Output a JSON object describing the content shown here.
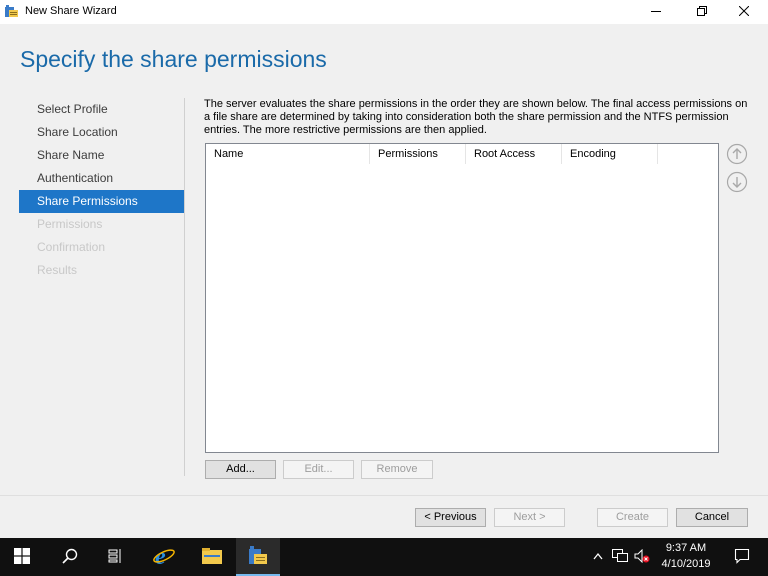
{
  "window": {
    "title": "New Share Wizard",
    "heading": "Specify the share permissions"
  },
  "nav": {
    "items": [
      {
        "label": "Select Profile",
        "state": "normal"
      },
      {
        "label": "Share Location",
        "state": "normal"
      },
      {
        "label": "Share Name",
        "state": "normal"
      },
      {
        "label": "Authentication",
        "state": "normal"
      },
      {
        "label": "Share Permissions",
        "state": "active"
      },
      {
        "label": "Permissions",
        "state": "disabled"
      },
      {
        "label": "Confirmation",
        "state": "disabled"
      },
      {
        "label": "Results",
        "state": "disabled"
      }
    ]
  },
  "description": "The server evaluates the share permissions in the order they are shown below. The final access permissions on a file share are determined by taking into consideration both the share permission and the NTFS permission entries. The more restrictive permissions are then applied.",
  "list": {
    "columns": [
      "Name",
      "Permissions",
      "Root Access",
      "Encoding"
    ],
    "rows": []
  },
  "list_buttons": {
    "add": "Add...",
    "edit": "Edit...",
    "remove": "Remove"
  },
  "footer": {
    "previous": "< Previous",
    "next": "Next >",
    "create": "Create",
    "cancel": "Cancel"
  },
  "taskbar": {
    "time": "9:37 AM",
    "date": "4/10/2019"
  },
  "colors": {
    "accent": "#1e76c8",
    "heading": "#1a6aa9",
    "taskbar": "#101010"
  },
  "icons": {
    "title": "share-wizard-icon",
    "move_up": "arrow-up-circle-icon",
    "move_down": "arrow-down-circle-icon",
    "start": "windows-logo-icon",
    "search": "search-icon",
    "task_view": "task-view-icon",
    "ie": "internet-explorer-icon",
    "explorer": "file-explorer-icon",
    "wizard": "share-wizard-icon",
    "network": "network-icon",
    "volume": "volume-muted-icon",
    "notifications": "notification-icon"
  }
}
